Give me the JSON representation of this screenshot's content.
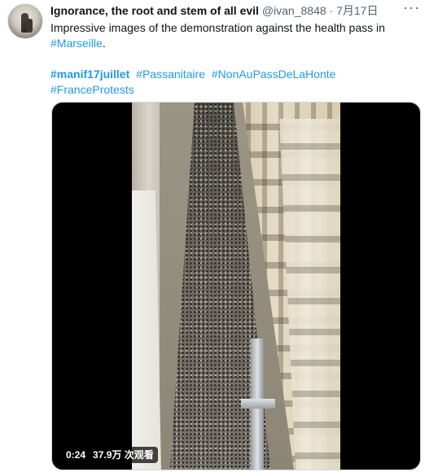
{
  "tweet": {
    "author_name": "Ignorance, the root and stem of all evil",
    "handle": "@ivan_8848",
    "separator": "·",
    "date": "7月17日",
    "more_label": "···",
    "text_main": "Impressive images of the demonstration against the health pass in",
    "text_link": "#Marseille",
    "text_end": ".",
    "hashtags": [
      "#manif17juillet",
      "#Passanitaire",
      "#NonAuPassDeLaHonte",
      "#FranceProtests"
    ]
  },
  "video": {
    "duration": "0:24",
    "views": "37.9万 次观看"
  },
  "colors": {
    "link": "#1d9bf0",
    "text": "#0f1419",
    "secondary": "#536471"
  },
  "icons": [
    "avatar-image",
    "more-options-icon"
  ]
}
